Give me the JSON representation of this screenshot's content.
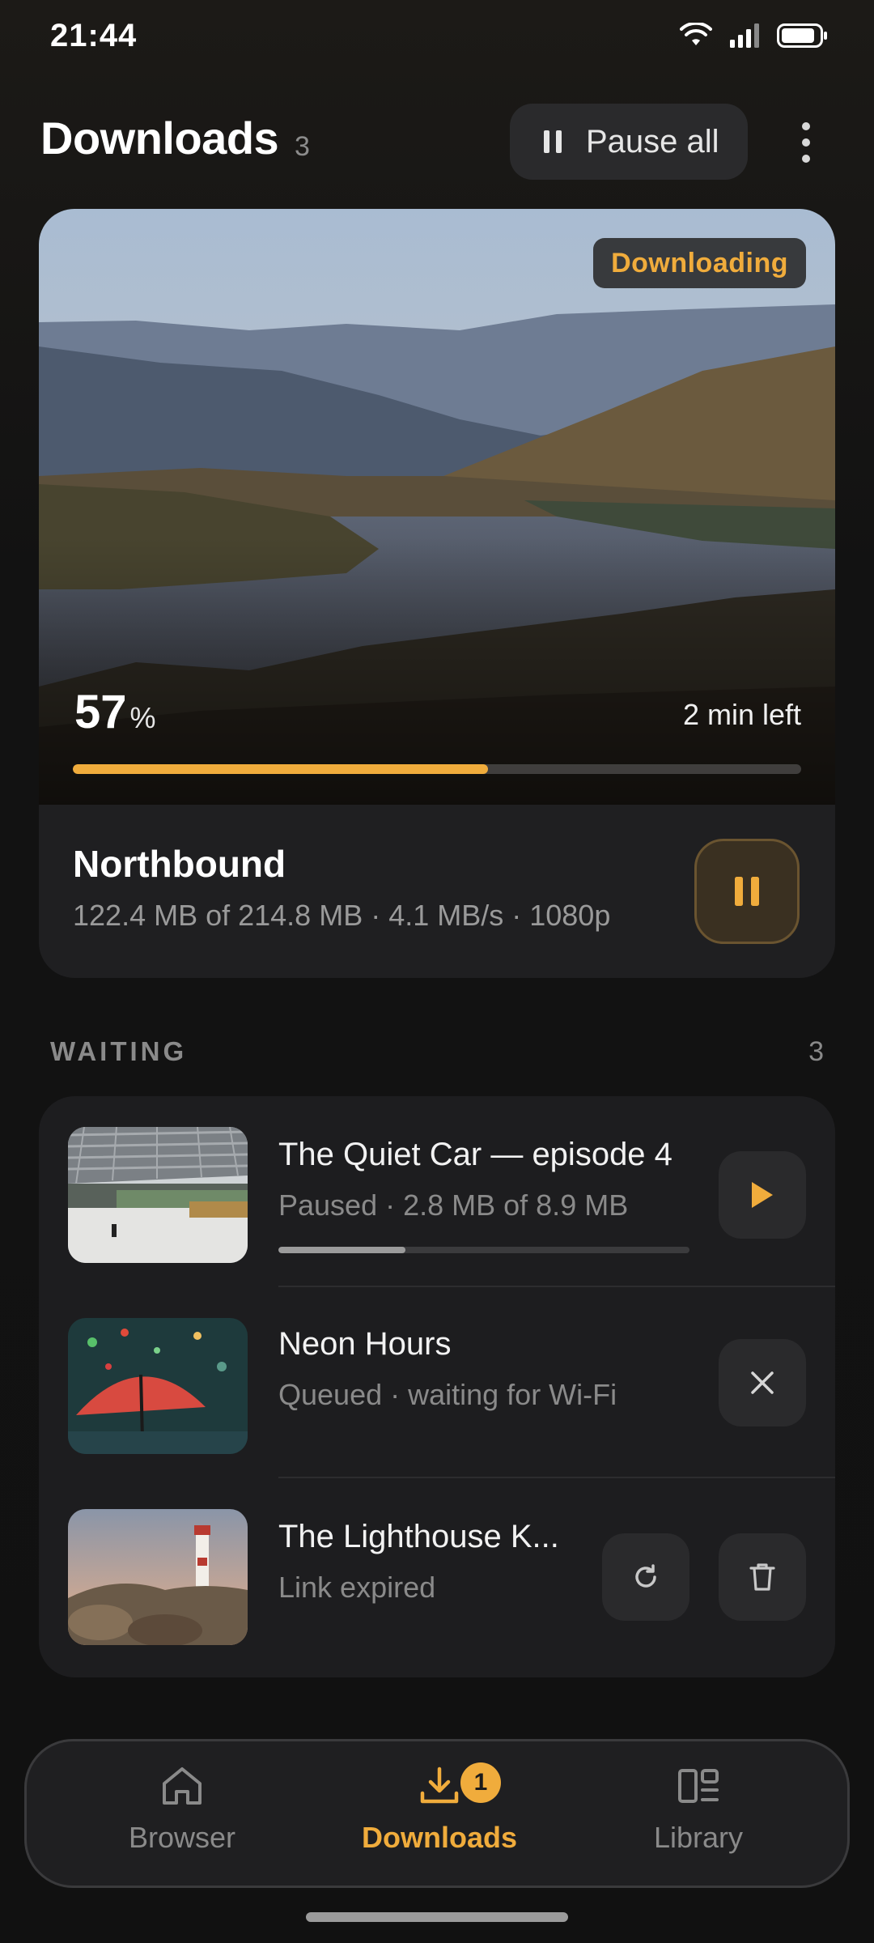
{
  "status_bar": {
    "time": "21:44",
    "icons": [
      "wifi-icon",
      "signal-icon",
      "battery-icon"
    ]
  },
  "header": {
    "title": "Downloads",
    "count": "3",
    "pause_all_label": "Pause all"
  },
  "active_download": {
    "badge": "Downloading",
    "percent": "57",
    "percent_sign": "%",
    "progress": 0.57,
    "eta": "2 min left",
    "title": "Northbound",
    "meta": "122.4 MB of 214.8 MB · 4.1 MB/s · 1080p"
  },
  "waiting_section": {
    "title": "WAITING",
    "count": "3",
    "items": [
      {
        "title": "The Quiet Car — episode 4",
        "subtitle": "Paused · 2.8 MB of 8.9 MB",
        "progress": 0.31,
        "actions": [
          "play-icon"
        ]
      },
      {
        "title": "Neon Hours",
        "subtitle": "Queued · waiting for Wi-Fi",
        "actions": [
          "close-icon"
        ]
      },
      {
        "title": "The Lighthouse K...",
        "subtitle": "Link expired",
        "actions": [
          "retry-icon",
          "trash-icon"
        ]
      }
    ]
  },
  "bottom_nav": {
    "items": [
      {
        "label": "Browser",
        "icon": "home-icon"
      },
      {
        "label": "Downloads",
        "icon": "download-icon",
        "badge": "1",
        "active": true
      },
      {
        "label": "Library",
        "icon": "library-icon"
      }
    ]
  },
  "colors": {
    "accent": "#f0ac3c",
    "background": "#121212",
    "card": "#1f1f21"
  }
}
